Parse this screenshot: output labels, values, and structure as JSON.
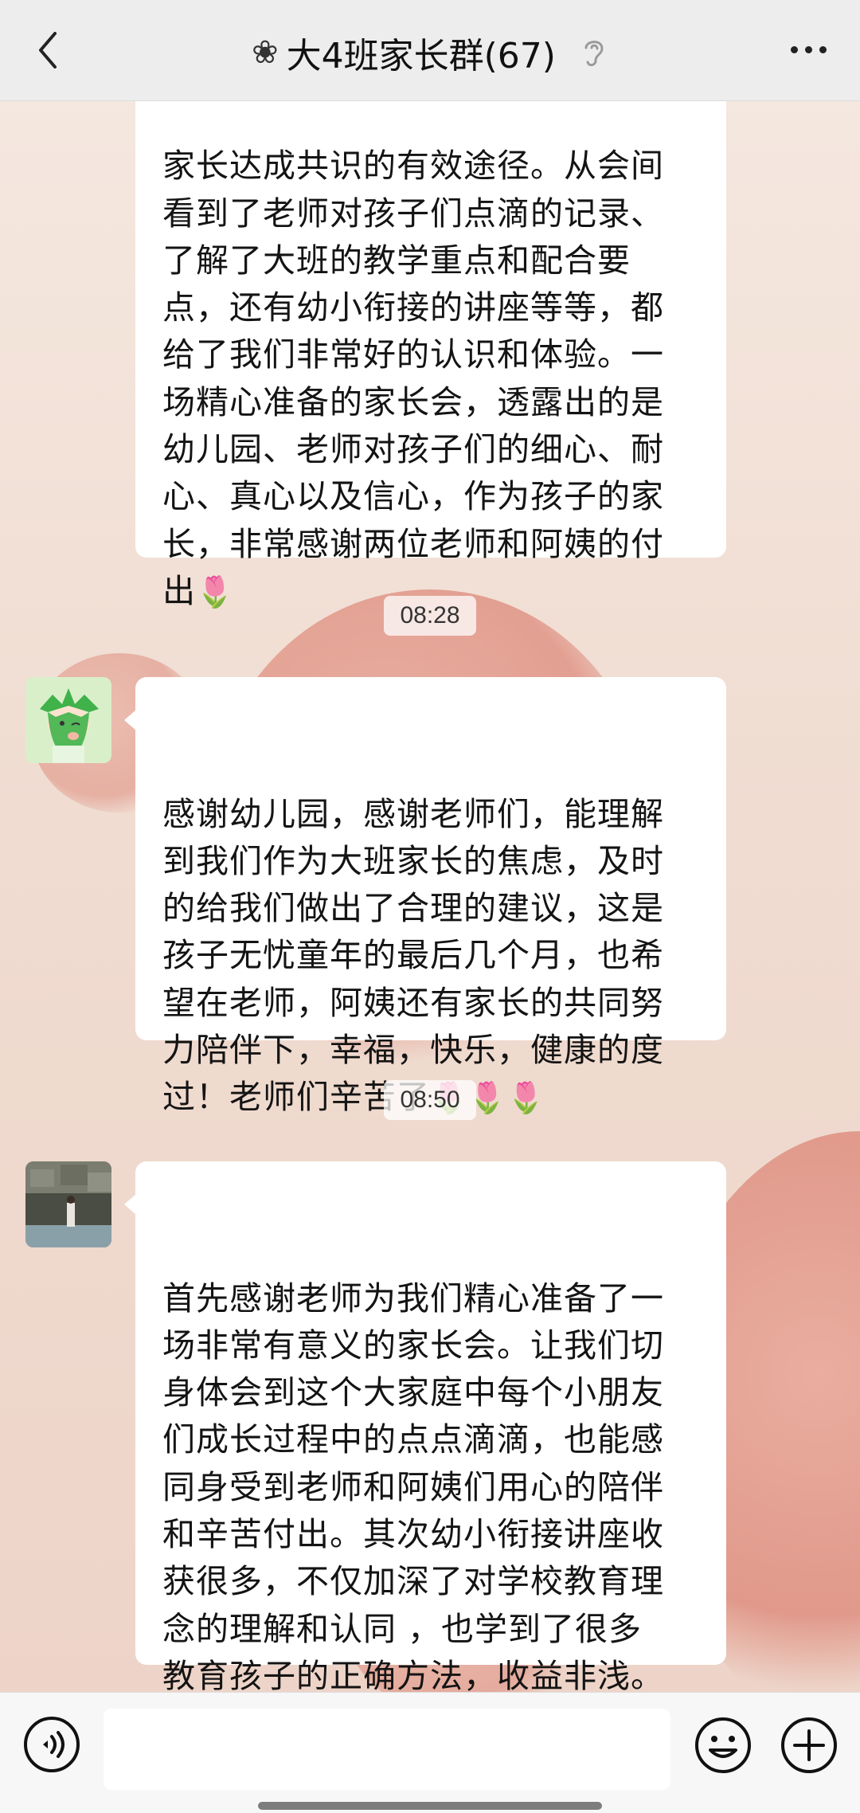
{
  "header": {
    "title_prefix": "❀",
    "title": "大4班家长群(67)"
  },
  "messages": [
    {
      "text": "家长达成共识的有效途径。从会间\n看到了老师对孩子们点滴的记录、\n了解了大班的教学重点和配合要\n点，还有幼小衔接的讲座等等，都\n给了我们非常好的认识和体验。一\n场精心准备的家长会，透露出的是\n幼儿园、老师对孩子们的细心、耐\n心、真心以及信心，作为孩子的家\n长，非常感谢两位老师和阿姨的付\n出",
      "emoji": "🌷"
    },
    {
      "text": "感谢幼儿园，感谢老师们，能理解\n到我们作为大班家长的焦虑，及时\n的给我们做出了合理的建议，这是\n孩子无忧童年的最后几个月，也希\n望在老师，阿姨还有家长的共同努\n力陪伴下，幸福，快乐，健康的度\n过！老师们辛苦了",
      "emoji": "🌷🌷🌷"
    },
    {
      "text": "首先感谢老师为我们精心准备了一\n场非常有意义的家长会。让我们切\n身体会到这个大家庭中每个小朋友\n们成长过程中的点点滴滴，也能感\n同身受到老师和阿姨们用心的陪伴\n和辛苦付出。其次幼小衔接讲座收\n获很多，不仅加深了对学校教育理\n念的理解和认同 ，也学到了很多\n教育孩子的正确方法，收益非浅。\n谢谢老师们和阿姨",
      "emoji": "🌹🌹🌹"
    }
  ],
  "timestamps": [
    "08:28",
    "08:50"
  ],
  "input": {
    "value": "",
    "placeholder": ""
  },
  "icons": {
    "back": "chevron-left-icon",
    "mute": "ear-mute-icon",
    "more": "more-dots-icon",
    "voice": "voice-icon",
    "emoji": "emoji-icon",
    "plus": "plus-icon"
  },
  "colors": {
    "header_bg": "#ededed",
    "bubble_bg": "#ffffff",
    "wallpaper": "#f0dcd1",
    "accent_blob": "#dd8a7b"
  }
}
